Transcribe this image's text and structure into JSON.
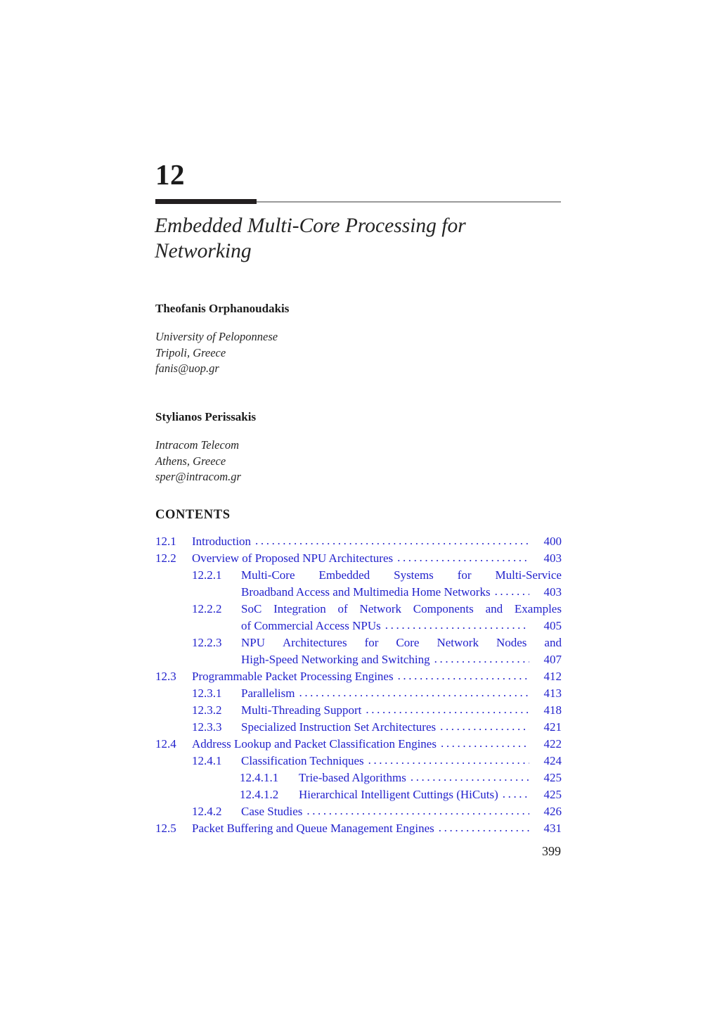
{
  "chapter": {
    "number": "12",
    "title_line1": "Embedded Multi-Core Processing for",
    "title_line2": "Networking"
  },
  "authors": [
    {
      "name": "Theofanis Orphanoudakis",
      "affiliation": "University of Peloponnese",
      "location": "Tripoli, Greece",
      "email": "fanis@uop.gr"
    },
    {
      "name": "Stylianos Perissakis",
      "affiliation": "Intracom Telecom",
      "location": "Athens, Greece",
      "email": "sper@intracom.gr"
    }
  ],
  "contents": {
    "heading": "CONTENTS",
    "entries": [
      {
        "number": "12.1",
        "level": 1,
        "lines": [
          "Introduction"
        ],
        "page": "400"
      },
      {
        "number": "12.2",
        "level": 1,
        "lines": [
          "Overview of Proposed NPU Architectures"
        ],
        "page": "403"
      },
      {
        "number": "12.2.1",
        "level": 2,
        "lines": [
          "Multi-Core Embedded Systems for Multi-Service",
          "Broadband Access and Multimedia Home Networks"
        ],
        "page": "403"
      },
      {
        "number": "12.2.2",
        "level": 2,
        "lines": [
          "SoC Integration of Network Components and Examples",
          "of Commercial Access NPUs"
        ],
        "page": "405"
      },
      {
        "number": "12.2.3",
        "level": 2,
        "lines": [
          "NPU Architectures for Core Network Nodes and",
          "High-Speed Networking and Switching"
        ],
        "page": "407"
      },
      {
        "number": "12.3",
        "level": 1,
        "lines": [
          "Programmable Packet Processing Engines"
        ],
        "page": "412"
      },
      {
        "number": "12.3.1",
        "level": 2,
        "lines": [
          "Parallelism"
        ],
        "page": "413"
      },
      {
        "number": "12.3.2",
        "level": 2,
        "lines": [
          "Multi-Threading Support"
        ],
        "page": "418"
      },
      {
        "number": "12.3.3",
        "level": 2,
        "lines": [
          "Specialized Instruction Set Architectures"
        ],
        "page": "421"
      },
      {
        "number": "12.4",
        "level": 1,
        "lines": [
          "Address Lookup and Packet Classification Engines"
        ],
        "page": "422"
      },
      {
        "number": "12.4.1",
        "level": 2,
        "lines": [
          "Classification Techniques"
        ],
        "page": "424"
      },
      {
        "number": "12.4.1.1",
        "level": 3,
        "lines": [
          "Trie-based Algorithms"
        ],
        "page": "425"
      },
      {
        "number": "12.4.1.2",
        "level": 3,
        "lines": [
          "Hierarchical Intelligent Cuttings (HiCuts)"
        ],
        "page": "425"
      },
      {
        "number": "12.4.2",
        "level": 2,
        "lines": [
          "Case Studies"
        ],
        "page": "426"
      },
      {
        "number": "12.5",
        "level": 1,
        "lines": [
          "Packet Buffering and Queue Management Engines"
        ],
        "page": "431"
      }
    ]
  },
  "folio": "399",
  "colors": {
    "toc_blue": "#2222cc",
    "rule_black": "#231f20",
    "rule_gray": "#9a9a9a"
  }
}
